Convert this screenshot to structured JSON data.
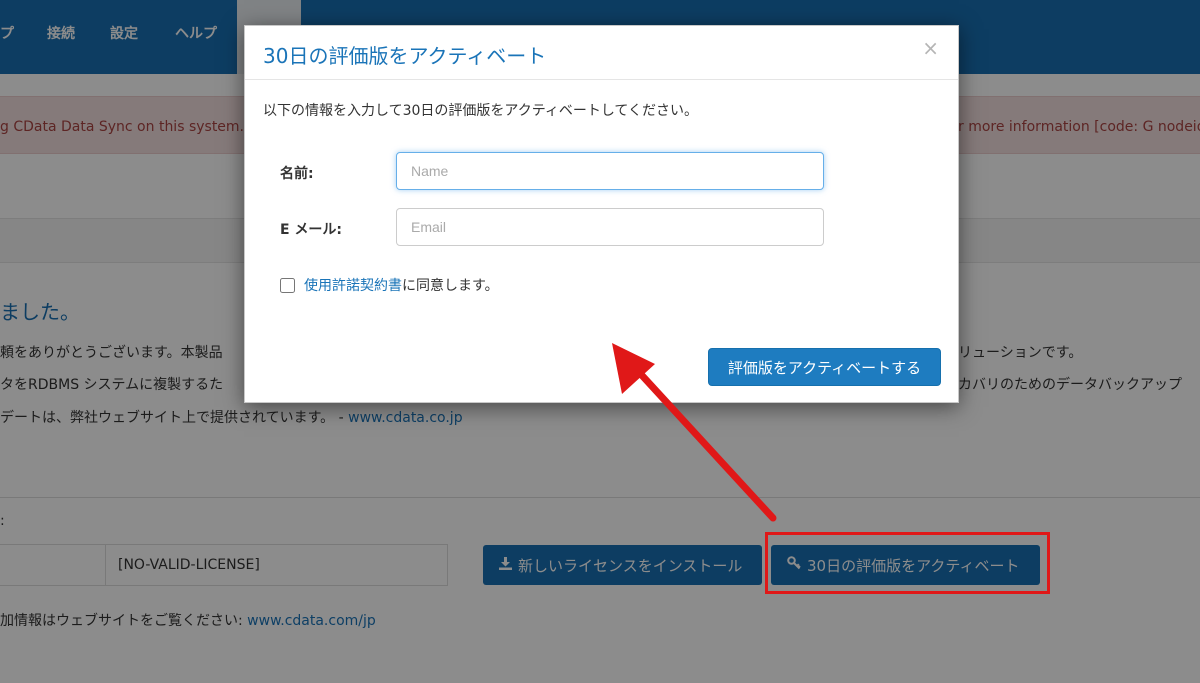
{
  "topnav": {
    "items": [
      "プ",
      "接続",
      "設定",
      "ヘルプ"
    ]
  },
  "alert": {
    "left_text": "g CData Data Sync on this system. To",
    "right_text": "r more information [code: G nodeid"
  },
  "content": {
    "heading_fragment": "ました。",
    "line1_left": "頼をありがとうございます。本製品",
    "line1_right": "リューションです。",
    "line2_left": "タをRDBMS システムに複製するた",
    "line2_right": "カバリのためのデータバックアップ",
    "line3_text": "デートは、弊社ウェブサイト上で提供されています。 - ",
    "line3_link": "www.cdata.co.jp",
    "section_label": ":",
    "license_value": "[NO-VALID-LICENSE]",
    "footer_text": "加情報はウェブサイトをご覧ください: ",
    "footer_link": "www.cdata.com/jp",
    "install_button": "新しいライセンスをインストール",
    "trial_button": "30日の評価版をアクティベート"
  },
  "modal": {
    "title": "30日の評価版をアクティベート",
    "close_glyph": "×",
    "intro": "以下の情報を入力して30日の評価版をアクティベートしてください。",
    "name_label": "名前:",
    "name_placeholder": "Name",
    "email_label": "E メール:",
    "email_placeholder": "Email",
    "agree_link": "使用許諾契約書",
    "agree_suffix": "に同意します。",
    "submit_button": "評価版をアクティベートする"
  },
  "icons": {
    "install_icon": "download-icon",
    "trial_icon": "key-icon"
  },
  "colors": {
    "brand_blue": "#1870b2",
    "callout_red": "#e01818",
    "alert_bg": "#f3dede"
  }
}
